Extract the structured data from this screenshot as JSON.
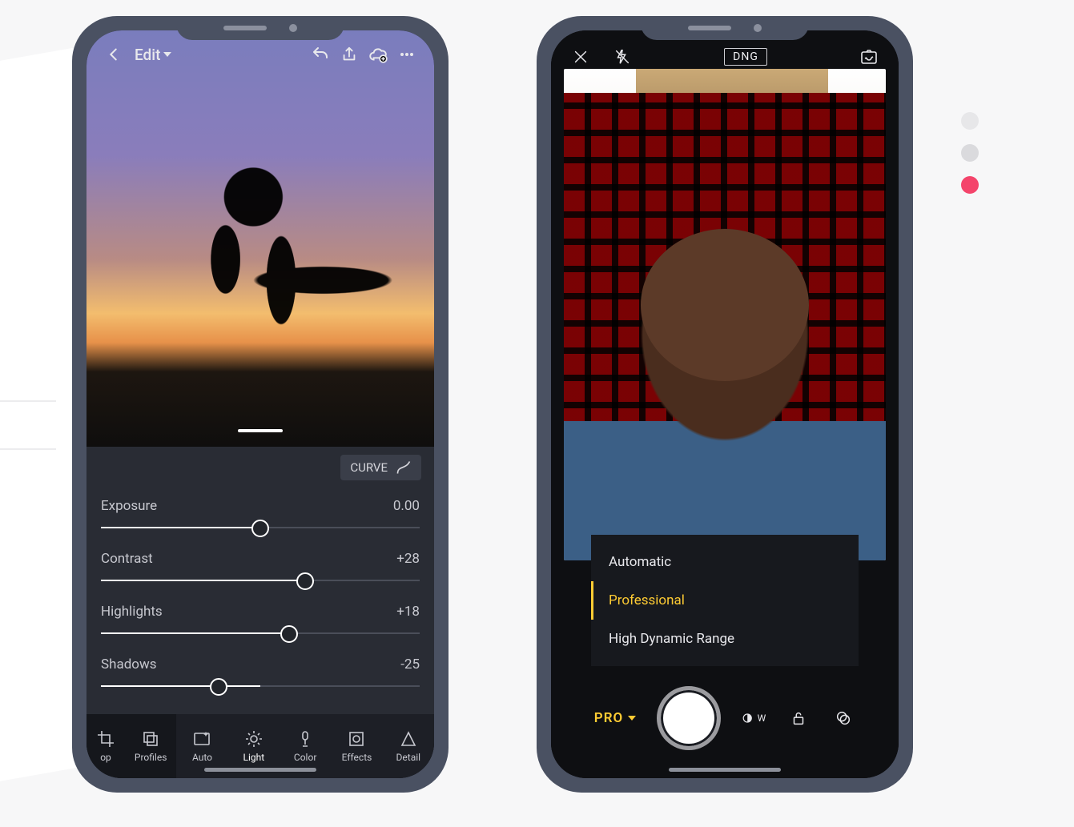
{
  "phone_a": {
    "nav": {
      "title": "Edit"
    },
    "curve_label": "CURVE",
    "sliders": [
      {
        "label": "Exposure",
        "value_text": "0.00",
        "percent": 50
      },
      {
        "label": "Contrast",
        "value_text": "+28",
        "percent": 64
      },
      {
        "label": "Highlights",
        "value_text": "+18",
        "percent": 59
      },
      {
        "label": "Shadows",
        "value_text": "-25",
        "percent": 37
      }
    ],
    "tools": [
      {
        "label": "op",
        "icon": "crop-icon"
      },
      {
        "label": "Profiles",
        "icon": "profiles-icon"
      },
      {
        "label": "Auto",
        "icon": "auto-icon"
      },
      {
        "label": "Light",
        "icon": "light-icon",
        "active": true
      },
      {
        "label": "Color",
        "icon": "color-icon"
      },
      {
        "label": "Effects",
        "icon": "effects-icon"
      },
      {
        "label": "Detail",
        "icon": "detail-icon"
      }
    ]
  },
  "phone_b": {
    "format_chip": "DNG",
    "modes": [
      {
        "label": "Automatic",
        "selected": false
      },
      {
        "label": "Professional",
        "selected": true
      },
      {
        "label": "High Dynamic Range",
        "selected": false
      }
    ],
    "mode_short": "PRO",
    "wb_label": "W"
  },
  "side_dots": {
    "colors": [
      "#e7e7e9",
      "#dadadd",
      "#f4446b"
    ]
  }
}
